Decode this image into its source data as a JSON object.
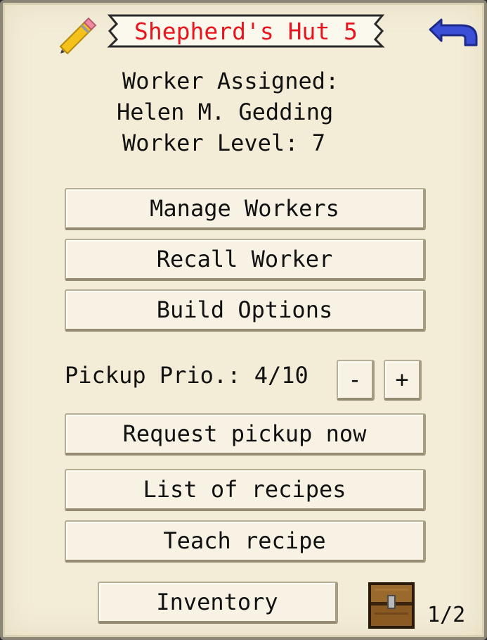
{
  "window": {
    "title": "Shepherd's Hut 5",
    "title_color": "#e8141e",
    "icons": {
      "edit": "pencil-icon",
      "back": "undo-arrow-icon"
    }
  },
  "worker": {
    "assigned_label": "Worker Assigned:",
    "name": "Helen M. Gedding",
    "level_text": "Worker Level: 7"
  },
  "buttons": {
    "manage_workers": "Manage Workers",
    "recall_worker": "Recall Worker",
    "build_options": "Build Options",
    "request_pickup": "Request pickup now",
    "list_recipes": "List of recipes",
    "teach_recipe": "Teach recipe",
    "inventory": "Inventory"
  },
  "pickup": {
    "label": "Pickup Prio.: 4/10",
    "minus": "-",
    "plus": "+"
  },
  "pager": {
    "icon": "chest-icon",
    "page": "1/2"
  }
}
